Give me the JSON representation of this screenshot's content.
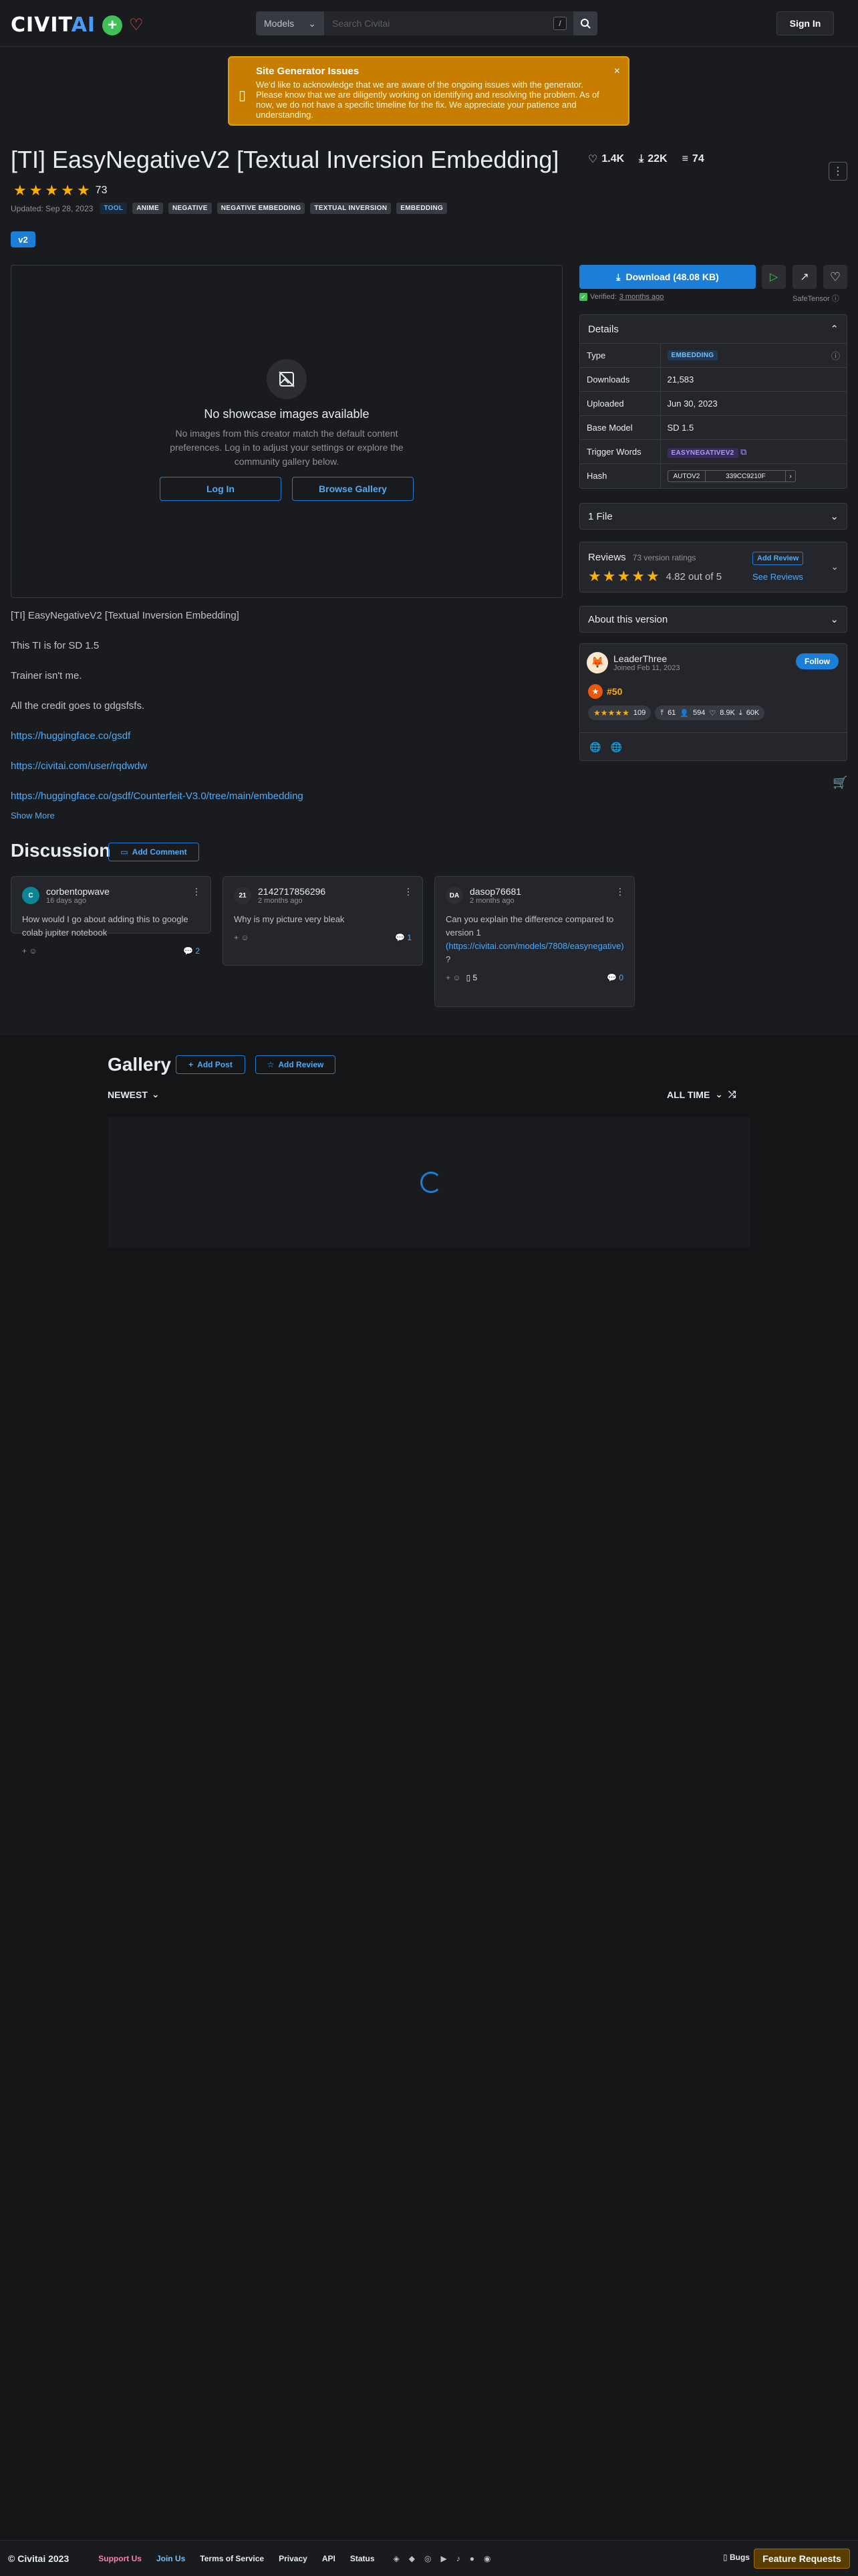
{
  "header": {
    "logo_civit": "CIVIT",
    "logo_ai": "AI",
    "search_type": "Models",
    "search_placeholder": "Search Civitai",
    "search_kbd": "/",
    "signin_label": "Sign In"
  },
  "alert": {
    "title": "Site Generator Issues",
    "body": "We'd like to acknowledge that we are aware of the ongoing issues with the generator. Please know that we are diligently working on identifying and resolving the problem. As of now, we do not have a specific timeline for the fix. We appreciate your patience and understanding."
  },
  "model": {
    "title": "[TI] EasyNegativeV2 [Textual Inversion Embedding]",
    "likes": "1.4K",
    "downloads_short": "22K",
    "comments": "74",
    "rating_count": "73",
    "updated": "Updated: Sep 28, 2023",
    "tags": [
      "TOOL",
      "ANIME",
      "NEGATIVE",
      "NEGATIVE EMBEDDING",
      "TEXTUAL INVERSION",
      "EMBEDDING"
    ],
    "version": "v2"
  },
  "showcase": {
    "heading": "No showcase images available",
    "text": "No images from this creator match the default content preferences. Log in to adjust your settings or explore the community gallery below.",
    "login_label": "Log In",
    "browse_label": "Browse Gallery"
  },
  "description": {
    "lines": [
      "[TI] EasyNegativeV2 [Textual Inversion Embedding]",
      "This TI is for SD 1.5",
      "Trainer isn't me.",
      "All the credit goes to gdgsfsfs."
    ],
    "links": [
      "https://huggingface.co/gsdf",
      "https://civitai.com/user/rqdwdw",
      "https://huggingface.co/gsdf/Counterfeit-V3.0/tree/main/embedding"
    ],
    "show_more": "Show More"
  },
  "sidebar": {
    "download_label": "Download (48.08 KB)",
    "verified_label": "Verified:",
    "verified_time": "3 months ago",
    "safetensor": "SafeTensor",
    "details_title": "Details",
    "details": {
      "type_label": "Type",
      "type_value": "EMBEDDING",
      "downloads_label": "Downloads",
      "downloads_value": "21,583",
      "uploaded_label": "Uploaded",
      "uploaded_value": "Jun 30, 2023",
      "base_label": "Base Model",
      "base_value": "SD 1.5",
      "trigger_label": "Trigger Words",
      "trigger_value": "EASYNEGATIVEV2",
      "hash_label": "Hash",
      "hash_algo": "AUTOV2",
      "hash_value": "339CC9210F"
    },
    "files_label": "1 File",
    "reviews_title": "Reviews",
    "reviews_count": "73 version ratings",
    "add_review": "Add Review",
    "rating_text": "4.82 out of 5",
    "see_reviews": "See Reviews",
    "about_version": "About this version"
  },
  "creator": {
    "name": "LeaderThree",
    "joined": "Joined Feb 11, 2023",
    "follow_label": "Follow",
    "rank": "#50",
    "rating_count": "109",
    "uploads": "61",
    "followers": "594",
    "likes": "8.9K",
    "downloads": "60K"
  },
  "discussion": {
    "title": "Discussion",
    "add_comment": "Add Comment",
    "comments": [
      {
        "avatar": "C",
        "user": "corbentopwave",
        "time": "16 days ago",
        "text": "How would I go about adding this to google colab jupiter notebook",
        "replies": "2",
        "reaction": ""
      },
      {
        "avatar": "21",
        "user": "2142717856296",
        "time": "2 months ago",
        "text": "Why is my picture very bleak",
        "replies": "1",
        "reaction": ""
      },
      {
        "avatar": "DA",
        "user": "dasop76681",
        "time": "2 months ago",
        "text": "Can you explain the difference compared to version 1",
        "link": "(https://civitai.com/models/7808/easynegative)",
        "after": " ?",
        "replies": "0",
        "reaction": "5"
      }
    ]
  },
  "gallery": {
    "title": "Gallery",
    "add_post": "Add Post",
    "add_review": "Add Review",
    "sort": "NEWEST",
    "period": "ALL TIME"
  },
  "footer": {
    "copyright": "© Civitai 2023",
    "support": "Support Us",
    "join": "Join Us",
    "terms": "Terms of Service",
    "privacy": "Privacy",
    "api": "API",
    "status": "Status",
    "bugs": "Bugs",
    "feature_requests": "Feature Requests"
  },
  "colors": {
    "accent": "#1c7ed6",
    "star": "#fab005",
    "alert": "#c77d00",
    "like": "#fa5252"
  }
}
